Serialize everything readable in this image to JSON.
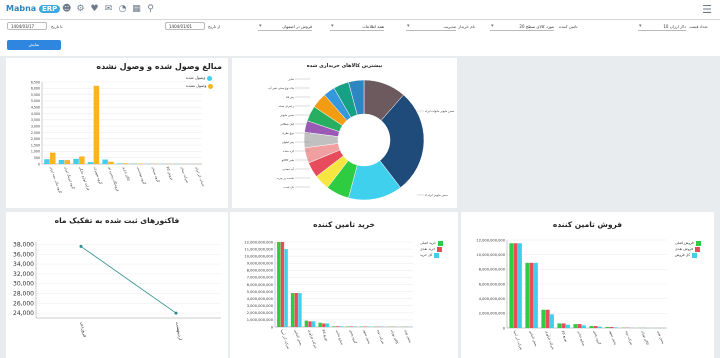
{
  "app": {
    "logo_text": "Mabna",
    "logo_badge": "ERP"
  },
  "toolbar_icons": [
    "user-icon",
    "settings-icon",
    "heart-icon",
    "mail-icon",
    "pie-chart-icon",
    "map-icon",
    "search-icon",
    "menu-icon"
  ],
  "filters": {
    "date_to_label": "تا تاریخ",
    "date_to_value": "1404/03/17",
    "date_from_label": "از تاریخ",
    "date_from_value": "1404/01/01",
    "group_select": "مدیریت",
    "group_type_select": "همه اطلاعات",
    "supplier_select": "فروش در اصفهان",
    "supplier_label": "تامین کننده",
    "counter_label": "تعداد قیمت",
    "counter_select": "10 دلار ارزان",
    "item_select": "20 مورد کالای سطح",
    "sub_label": "نام خریدار",
    "submit_label": "نمایش"
  },
  "colors": {
    "cyan": "#3fd0ee",
    "orange": "#f9b51f",
    "red": "#e74c5c",
    "green": "#2ecc40",
    "navy": "#1e4b7a",
    "teal": "#2e8b8b"
  },
  "chart_data": [
    {
      "type": "bar",
      "title": "مبالغ وصول شده و وصول نشده",
      "ylim": [
        0,
        6500
      ],
      "y_ticks": [
        "6,500",
        "6,000",
        "5,500",
        "5,000",
        "4,500",
        "4,000",
        "3,500",
        "3,000",
        "2,500",
        "2,000",
        "1,500",
        "1,000",
        "500",
        "0"
      ],
      "legend_placement": "top-right",
      "categories": [
        "گروه مالی بیمه ایران",
        "گروه لیزینگ ایران",
        "فرآیند لوازم خانگی",
        "گروه تجهیزات",
        "فروشگاه زنجیره ای",
        "کالای اداری",
        "گروه مهندسی",
        "گروه سیمان",
        "فروش کالا",
        "شرکت پیمان",
        "حساب اثر ایران"
      ],
      "series": [
        {
          "name": "وصول شده",
          "values": [
            380,
            320,
            410,
            150,
            350,
            50,
            30,
            20,
            10,
            10,
            5
          ]
        },
        {
          "name": "وصول نشده",
          "values": [
            900,
            310,
            600,
            6200,
            180,
            60,
            40,
            20,
            15,
            10,
            5
          ]
        }
      ]
    },
    {
      "type": "pie",
      "title": "بیشترین کالاهای خریداری شده",
      "slices": [
        {
          "label": "سایر",
          "value": 11,
          "color": "#6d5a5e"
        },
        {
          "label": "سس مایونز خانواده ابراه",
          "value": 27,
          "color": "#1e4b7a"
        },
        {
          "label": "سس مایونز خانواده ابراه 2",
          "value": 14,
          "color": "#3fd0ee"
        },
        {
          "label": "لیموناد گلدن ساقه لیتر",
          "value": 6,
          "color": "#2ecc40"
        },
        {
          "label": "کنسرو ماهی",
          "value": 4,
          "color": "#f5e642"
        },
        {
          "label": "کیک شکلاتی",
          "value": 4,
          "color": "#e74c5c"
        },
        {
          "label": "روغن آفتابگردان",
          "value": 4,
          "color": "#f0a0a0"
        },
        {
          "label": "لیموناد خنک",
          "value": 4,
          "color": "#c0c0c0"
        },
        {
          "label": "نوشابه گازدار",
          "value": 3,
          "color": "#9b59b6"
        },
        {
          "label": "ماکارونی",
          "value": 4,
          "color": "#27ae60"
        },
        {
          "label": "شیر پاستوریزه",
          "value": 4,
          "color": "#f39c12"
        },
        {
          "label": "پفک نمکی",
          "value": 3,
          "color": "#3498db"
        },
        {
          "label": "نان تست",
          "value": 4,
          "color": "#16a085"
        },
        {
          "label": "کره ساده",
          "value": 4,
          "color": "#2e86c1"
        }
      ],
      "slice_labels_left": [
        "سایر",
        "ماء دوغ سنتی شیر آب",
        "پنیر فتا",
        "زعفران بسته",
        "سس مایونز",
        "کیک شکلاتی",
        "دوغ بطری",
        "پنیر لیقوان",
        "کره ساده",
        "شیر کاکائو",
        "آب معدنی",
        "ماست پر چرب",
        "نان تست"
      ],
      "slice_labels_right": [
        "سس مایونز خانواده ابراه",
        "سس مایونز ابراه 2"
      ]
    },
    {
      "type": "line",
      "title": "فاکتورهای ثبت شده به تفکیک ماه",
      "categories": [
        "فروردین",
        "اردیبهشت"
      ],
      "values": [
        37600,
        24000
      ],
      "ylim": [
        23000,
        38500
      ],
      "y_ticks": [
        "38,000",
        "36,000",
        "34,000",
        "32,000",
        "30,000",
        "28,000",
        "26,000",
        "24,000"
      ]
    },
    {
      "type": "bar",
      "title": "خرید تامین کننده",
      "ylim": [
        0,
        12000000000
      ],
      "y_ticks": [
        "12,000,000,000",
        "11,000,000,000",
        "10,000,000,000",
        "9,000,000,000",
        "8,000,000,000",
        "7,000,000,000",
        "6,000,000,000",
        "5,000,000,000",
        "4,000,000,000",
        "3,000,000,000",
        "2,000,000,000",
        "1,000,000,000",
        "0"
      ],
      "legend_placement": "top-right",
      "categories": [
        "شرکت آذر آسیا",
        "پخش الماس",
        "شرکت فرآوری",
        "توزیع کالا",
        "صنایع غذایی",
        "گروه پخش",
        "پخش سپهر",
        "شرکت نوید",
        "کالای تهران",
        "پخش نوین"
      ],
      "series": [
        {
          "name": "خرید اصلی",
          "values": [
            12000000000,
            4800000000,
            900000000,
            600000000,
            100000000,
            80000000,
            60000000,
            50000000,
            40000000,
            30000000
          ]
        },
        {
          "name": "خرید نقدی",
          "values": [
            12000000000,
            4800000000,
            800000000,
            500000000,
            100000000,
            80000000,
            60000000,
            50000000,
            40000000,
            30000000
          ]
        },
        {
          "name": "کل خرید",
          "values": [
            11000000000,
            4800000000,
            800000000,
            500000000,
            100000000,
            80000000,
            60000000,
            50000000,
            40000000,
            30000000
          ]
        }
      ]
    },
    {
      "type": "bar",
      "title": "فروش تامین کننده",
      "ylim": [
        0,
        13500000000
      ],
      "y_ticks": [
        "12,000,000,000",
        "10,000,000,000",
        "8,000,000,000",
        "6,000,000,000",
        "4,000,000,000",
        "2,000,000,000",
        "0"
      ],
      "legend_placement": "top-right",
      "categories": [
        "شرکت آذر آسیا",
        "پخش الماس",
        "شرکت فرآوری",
        "توزیع کالا",
        "صنایع غذایی",
        "گروه پخش",
        "پخش سپهر",
        "شرکت نوید",
        "کالای تهران",
        "پخش نوین"
      ],
      "series": [
        {
          "name": "فروش اصلی",
          "values": [
            13000000000,
            10000000000,
            2800000000,
            700000000,
            600000000,
            300000000,
            150000000,
            50000000,
            20000000,
            10000000
          ]
        },
        {
          "name": "فروش نقدی",
          "values": [
            13000000000,
            10000000000,
            2800000000,
            700000000,
            600000000,
            300000000,
            150000000,
            50000000,
            20000000,
            10000000
          ]
        },
        {
          "name": "کل فروش",
          "values": [
            13000000000,
            10000000000,
            2100000000,
            500000000,
            400000000,
            200000000,
            100000000,
            30000000,
            10000000,
            5000000
          ]
        }
      ]
    }
  ]
}
